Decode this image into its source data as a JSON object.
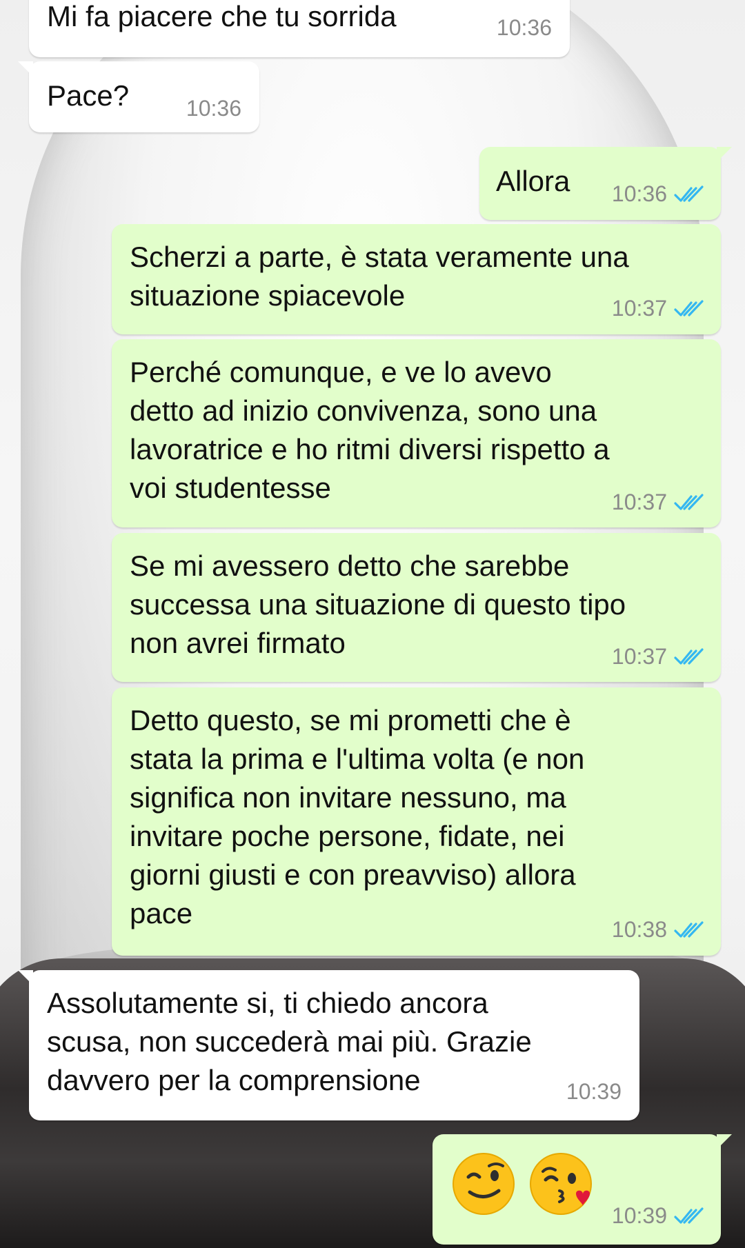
{
  "theme": {
    "incoming_bg": "#ffffff",
    "outgoing_bg": "#e2fecb",
    "time_color": "#8a8a8a",
    "read_tick_color": "#34b7f1"
  },
  "messages": [
    {
      "direction": "in",
      "text": "Mi fa piacere che tu sorrida",
      "time": "10:36"
    },
    {
      "direction": "in",
      "text": "Pace?",
      "time": "10:36"
    },
    {
      "direction": "out",
      "text": "Allora",
      "time": "10:36",
      "status": "read"
    },
    {
      "direction": "out",
      "text": "Scherzi a parte, è stata veramente una\nsituazione spiacevole",
      "time": "10:37",
      "status": "read"
    },
    {
      "direction": "out",
      "text": "Perché comunque, e ve lo avevo\ndetto ad inizio convivenza, sono una\nlavoratrice e ho ritmi diversi rispetto a\nvoi studentesse",
      "time": "10:37",
      "status": "read"
    },
    {
      "direction": "out",
      "text": "Se mi avessero detto che sarebbe\nsuccessa una situazione di questo tipo\nnon avrei firmato",
      "time": "10:37",
      "status": "read"
    },
    {
      "direction": "out",
      "text": "Detto questo, se mi prometti che è\nstata la prima e l'ultima volta (e non\nsignifica non invitare nessuno, ma\ninvitare poche persone, fidate, nei\ngiorni giusti e con preavviso) allora\npace",
      "time": "10:38",
      "status": "read"
    },
    {
      "direction": "in",
      "text": "Assolutamente si, ti chiedo ancora\nscusa, non succederà mai più. Grazie\ndavvero per la comprensione",
      "time": "10:39"
    },
    {
      "direction": "out",
      "emoji_icons": [
        "winking-face-icon",
        "face-blowing-kiss-icon"
      ],
      "time": "10:39",
      "status": "read"
    }
  ]
}
